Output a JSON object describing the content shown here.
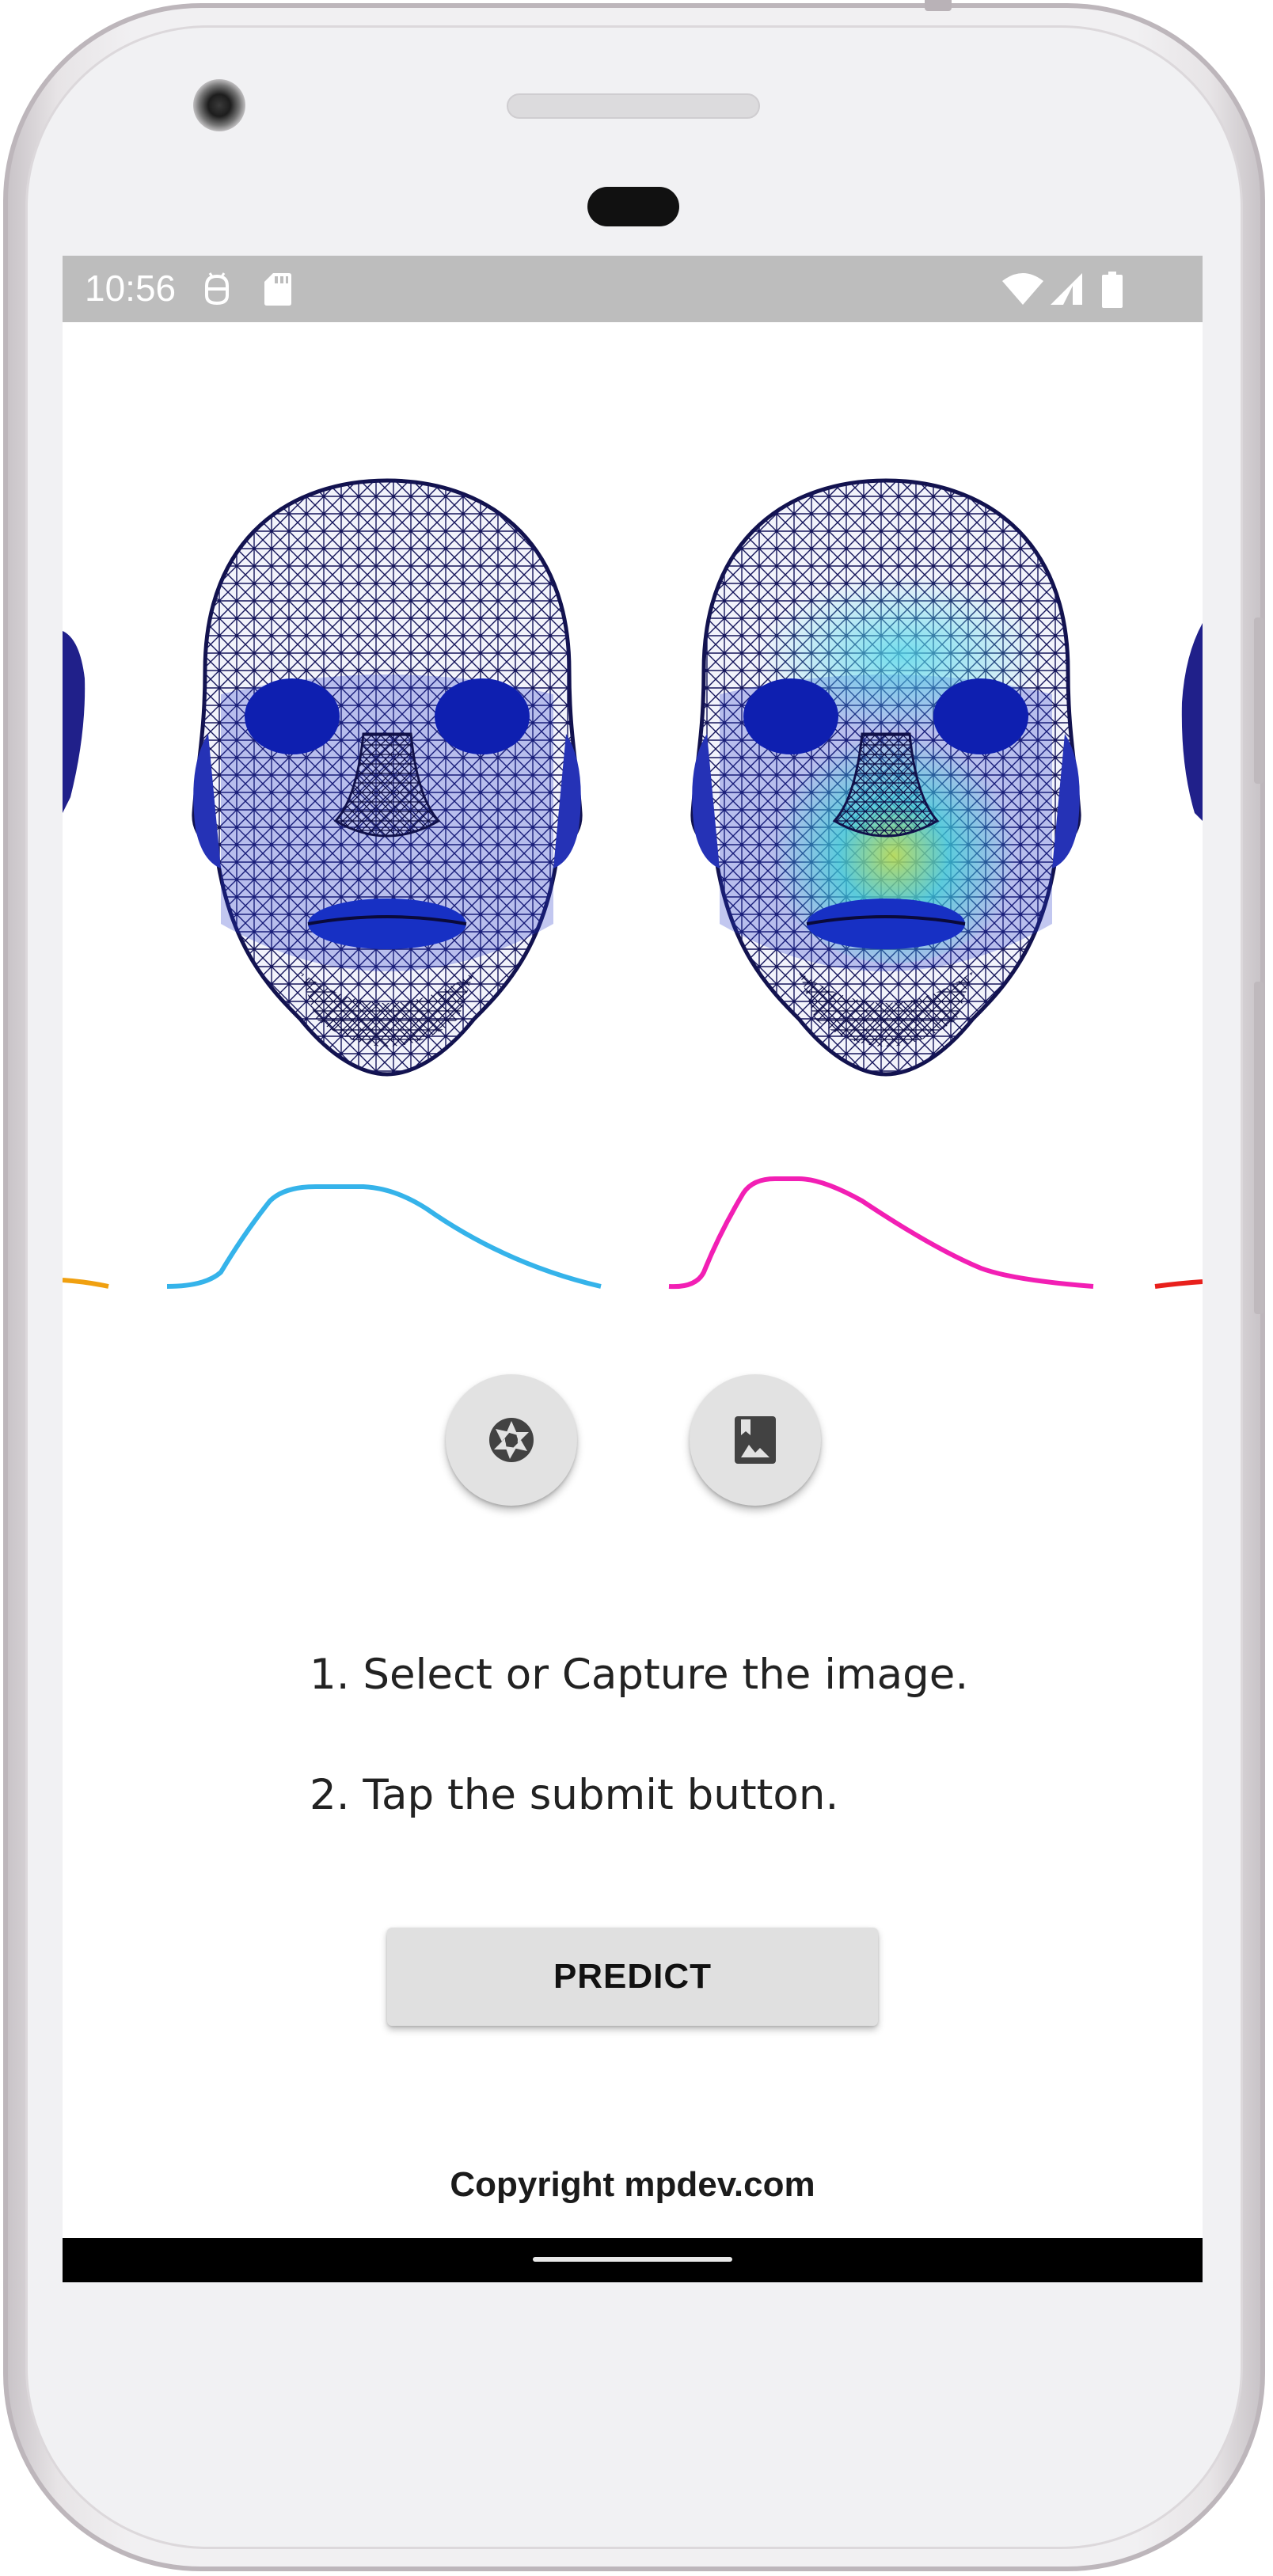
{
  "status_bar": {
    "time": "10:56",
    "icons": [
      "android-debug-icon",
      "sd-card-icon",
      "wifi-icon",
      "signal-icon",
      "battery-icon"
    ]
  },
  "hero": {
    "faces": [
      "plain-mesh-face",
      "heatmap-mesh-face"
    ],
    "curve_colors": [
      "#f0a010",
      "#35b3ea",
      "#f21fb4",
      "#e8201c"
    ]
  },
  "actions": {
    "camera_icon": "camera-shutter-icon",
    "gallery_icon": "photo-album-icon"
  },
  "instructions": [
    "1. Select or Capture the image.",
    "2. Tap the submit button."
  ],
  "predict_label": "PREDICT",
  "copyright": "Copyright mpdev.com"
}
